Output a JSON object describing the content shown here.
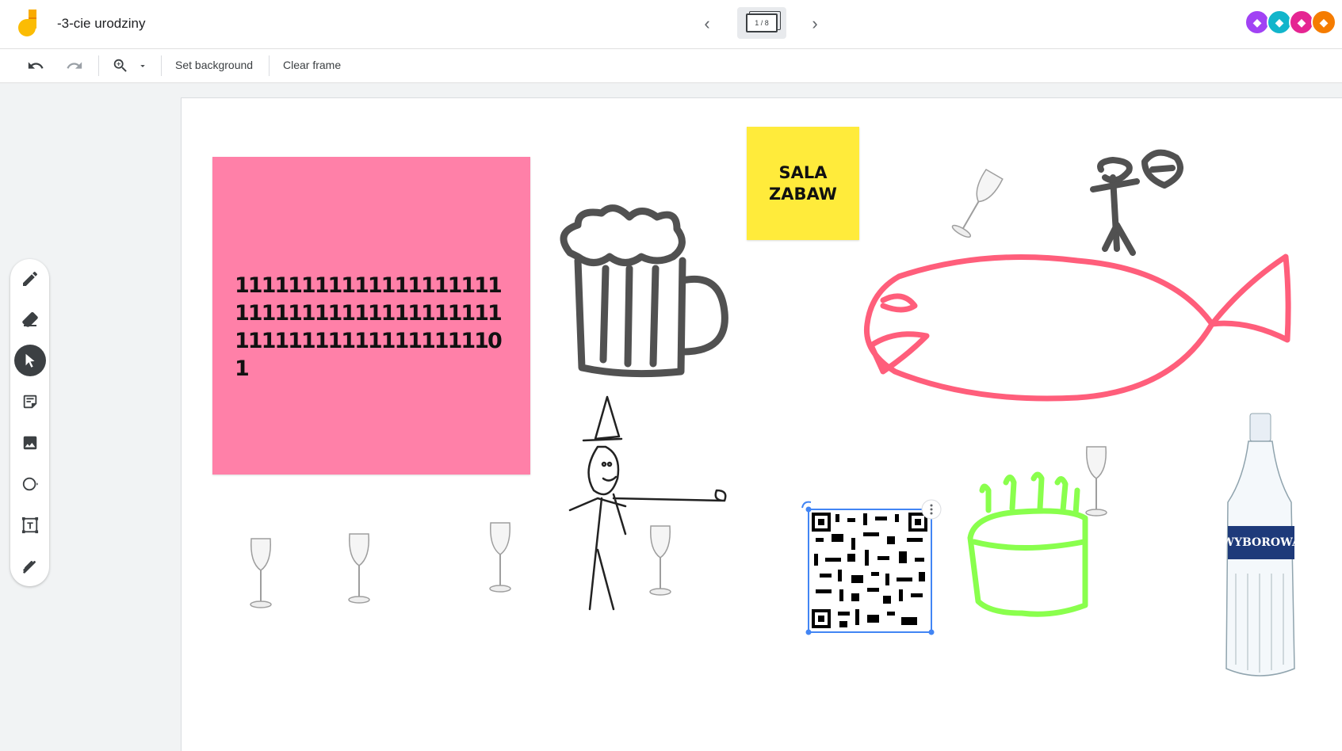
{
  "header": {
    "title": "-3-cie urodziny",
    "frame_indicator": "1 / 8",
    "prev_icon": "chevron-left-icon",
    "next_icon": "chevron-right-icon"
  },
  "avatars": [
    {
      "name": "avatar-purple",
      "color": "#a142f4"
    },
    {
      "name": "avatar-teal",
      "color": "#12b5cb"
    },
    {
      "name": "avatar-pink",
      "color": "#e52592"
    },
    {
      "name": "avatar-orange",
      "color": "#f9ab00"
    }
  ],
  "toolbar": {
    "set_background": "Set background",
    "clear_frame": "Clear frame"
  },
  "tools": [
    "pen-icon",
    "eraser-icon",
    "select-icon",
    "sticky-note-icon",
    "image-icon",
    "shape-circle-icon",
    "text-box-icon",
    "laser-icon"
  ],
  "canvas": {
    "pink_note": "1111111111111111111111111111111111111111111111111111111111101",
    "yellow_note": "SALA ZABAW",
    "bottle_label": "WYBOROWA"
  },
  "colors": {
    "pink_note": "#ff80a8",
    "yellow_note": "#ffeb3b",
    "fish_stroke": "#ff4d6d",
    "cake_stroke": "#7dff3a",
    "selection": "#4285f4"
  }
}
